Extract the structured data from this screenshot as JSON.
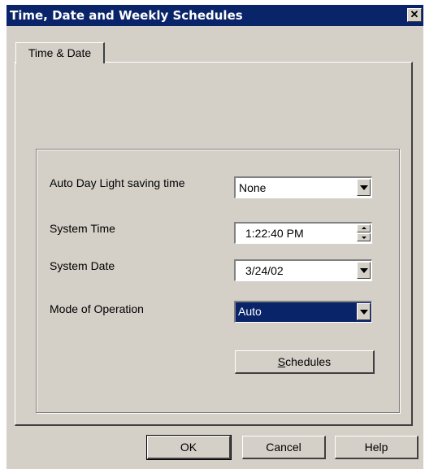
{
  "window": {
    "title": "Time, Date and Weekly Schedules",
    "close_glyph": "✕"
  },
  "tabs": [
    {
      "label": "Time & Date"
    }
  ],
  "form": {
    "dst_label": "Auto Day Light saving time",
    "dst_value": "None",
    "time_label": "System Time",
    "time_value": "1:22:40 PM",
    "date_label": "System Date",
    "date_value": "3/24/02",
    "mode_label": "Mode of Operation",
    "mode_value": "Auto",
    "schedules_label": "Schedules"
  },
  "footer": {
    "ok_label": "OK",
    "cancel_label": "Cancel",
    "help_label": "Help"
  },
  "colors": {
    "titlebar": "#0a246a",
    "face": "#d4d0c8",
    "selection": "#0a246a"
  }
}
